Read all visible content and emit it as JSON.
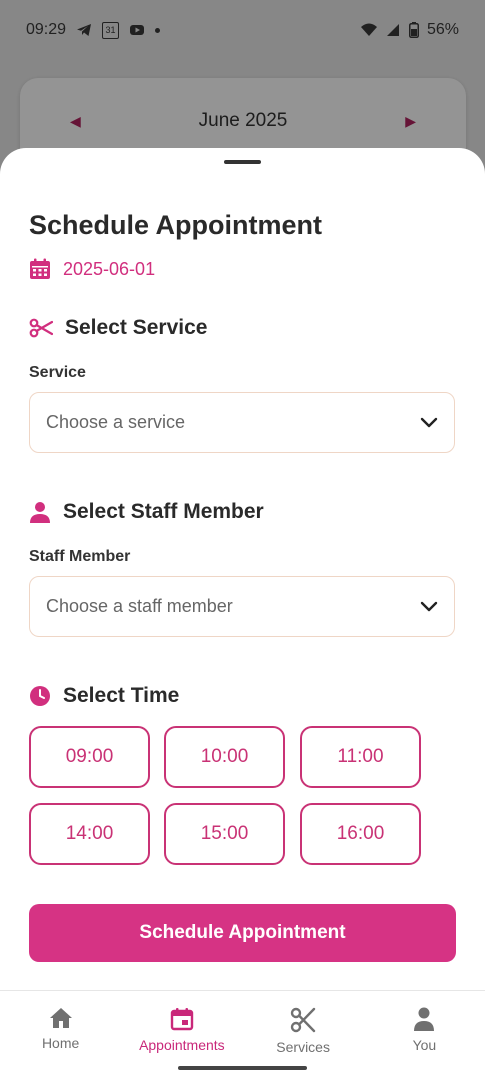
{
  "status_bar": {
    "time": "09:29",
    "calendar_day": "31",
    "battery": "56%"
  },
  "background_calendar": {
    "month": "June 2025"
  },
  "sheet": {
    "title": "Schedule Appointment",
    "date": "2025-06-01"
  },
  "service_section": {
    "heading": "Select Service",
    "label": "Service",
    "placeholder": "Choose a service"
  },
  "staff_section": {
    "heading": "Select Staff Member",
    "label": "Staff Member",
    "placeholder": "Choose a staff member"
  },
  "time_section": {
    "heading": "Select Time",
    "slots": [
      "09:00",
      "10:00",
      "11:00",
      "14:00",
      "15:00",
      "16:00"
    ]
  },
  "submit_label": "Schedule Appointment",
  "bottom_nav": {
    "items": [
      {
        "label": "Home",
        "icon": "home-icon",
        "active": false
      },
      {
        "label": "Appointments",
        "icon": "calendar-icon",
        "active": true
      },
      {
        "label": "Services",
        "icon": "scissors-icon",
        "active": false
      },
      {
        "label": "You",
        "icon": "person-icon",
        "active": false
      }
    ]
  },
  "colors": {
    "accent": "#d63384",
    "accent_text": "#c93275",
    "field_border": "#efd6c6"
  }
}
